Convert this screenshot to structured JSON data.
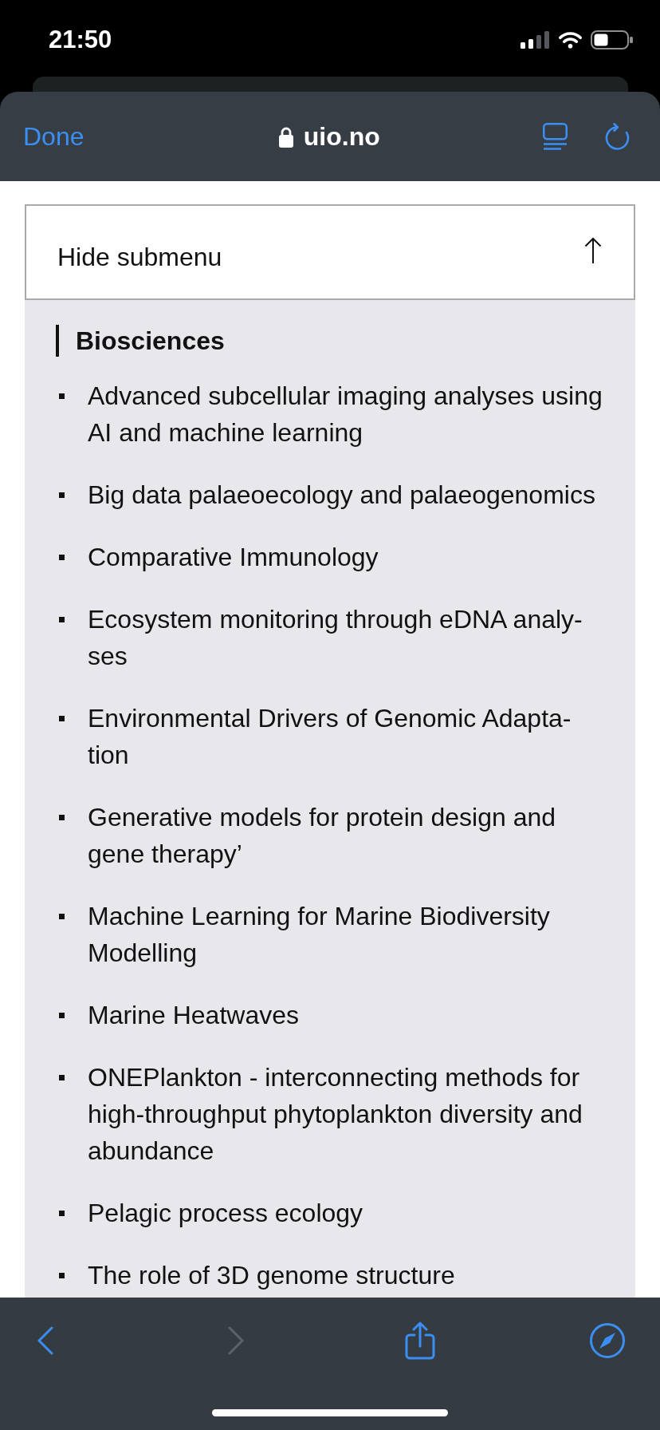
{
  "status_bar": {
    "time": "21:50"
  },
  "browser_header": {
    "done_button": "Done",
    "address": "uio.no",
    "secure": true
  },
  "submenu_toggle": {
    "label": "Hide submenu"
  },
  "submenu": {
    "heading": "Biosciences",
    "items": [
      "Advanced subcellular imaging analyses using AI and machine learning",
      "Big data palaeoecology and palaeogenomics",
      "Comparative Immunology",
      "Ecosystem monitoring through eDNA analy-ses",
      "Environmental Drivers of Genomic Adapta-tion",
      "Generative models for protein design and gene therapy’",
      "Machine Learning for Marine Biodiversity Modelling",
      "Marine Heatwaves",
      "ONEPlankton - interconnecting methods for high-throughput phytoplankton diversity and abundance",
      "Pelagic process ecology",
      "The role of 3D genome structure"
    ]
  },
  "toolbar": {
    "back": {
      "disabled": false
    },
    "forward": {
      "disabled": true
    }
  }
}
